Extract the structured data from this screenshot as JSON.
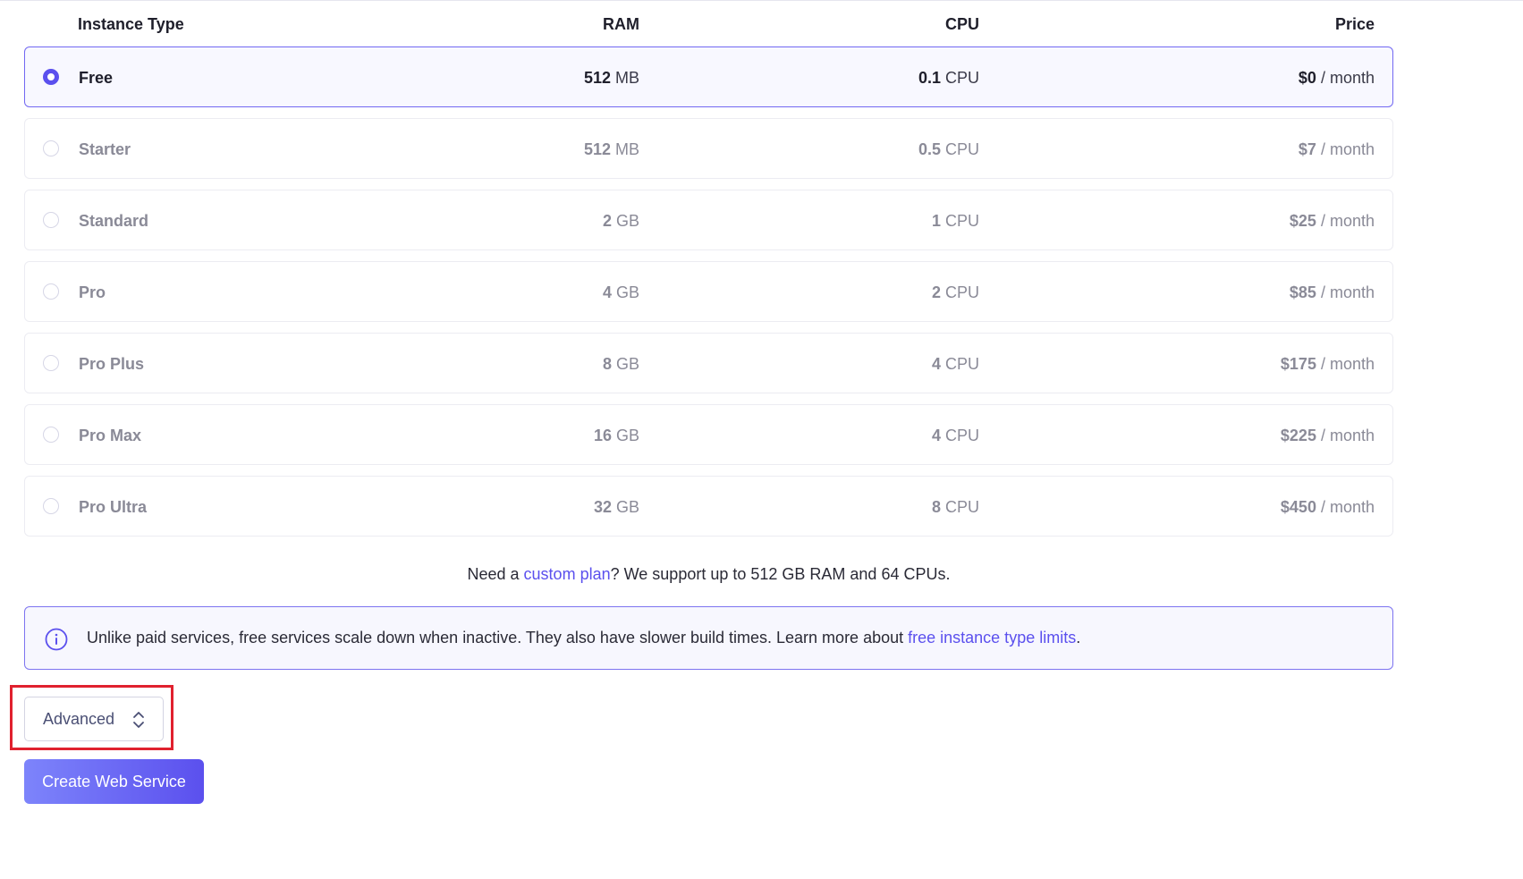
{
  "table": {
    "headers": {
      "type": "Instance Type",
      "ram": "RAM",
      "cpu": "CPU",
      "price": "Price"
    },
    "plans": [
      {
        "name": "Free",
        "ram_value": "512",
        "ram_unit": "MB",
        "cpu_value": "0.1",
        "cpu_unit": "CPU",
        "price_value": "$0",
        "price_unit": "/ month",
        "selected": true
      },
      {
        "name": "Starter",
        "ram_value": "512",
        "ram_unit": "MB",
        "cpu_value": "0.5",
        "cpu_unit": "CPU",
        "price_value": "$7",
        "price_unit": "/ month",
        "selected": false
      },
      {
        "name": "Standard",
        "ram_value": "2",
        "ram_unit": "GB",
        "cpu_value": "1",
        "cpu_unit": "CPU",
        "price_value": "$25",
        "price_unit": "/ month",
        "selected": false
      },
      {
        "name": "Pro",
        "ram_value": "4",
        "ram_unit": "GB",
        "cpu_value": "2",
        "cpu_unit": "CPU",
        "price_value": "$85",
        "price_unit": "/ month",
        "selected": false
      },
      {
        "name": "Pro Plus",
        "ram_value": "8",
        "ram_unit": "GB",
        "cpu_value": "4",
        "cpu_unit": "CPU",
        "price_value": "$175",
        "price_unit": "/ month",
        "selected": false
      },
      {
        "name": "Pro Max",
        "ram_value": "16",
        "ram_unit": "GB",
        "cpu_value": "4",
        "cpu_unit": "CPU",
        "price_value": "$225",
        "price_unit": "/ month",
        "selected": false
      },
      {
        "name": "Pro Ultra",
        "ram_value": "32",
        "ram_unit": "GB",
        "cpu_value": "8",
        "cpu_unit": "CPU",
        "price_value": "$450",
        "price_unit": "/ month",
        "selected": false
      }
    ]
  },
  "custom_note": {
    "prefix": "Need a ",
    "link": "custom plan",
    "suffix": "? We support up to 512 GB RAM and 64 CPUs."
  },
  "info": {
    "icon": "info-icon",
    "text": "Unlike paid services, free services scale down when inactive. They also have slower build times. Learn more about ",
    "link": "free instance type limits",
    "suffix": "."
  },
  "advanced": {
    "label": "Advanced",
    "icon": "chevron-up-down-icon"
  },
  "create_button": {
    "label": "Create Web Service"
  },
  "colors": {
    "accent": "#5b50ee",
    "highlight": "#e0212e"
  }
}
